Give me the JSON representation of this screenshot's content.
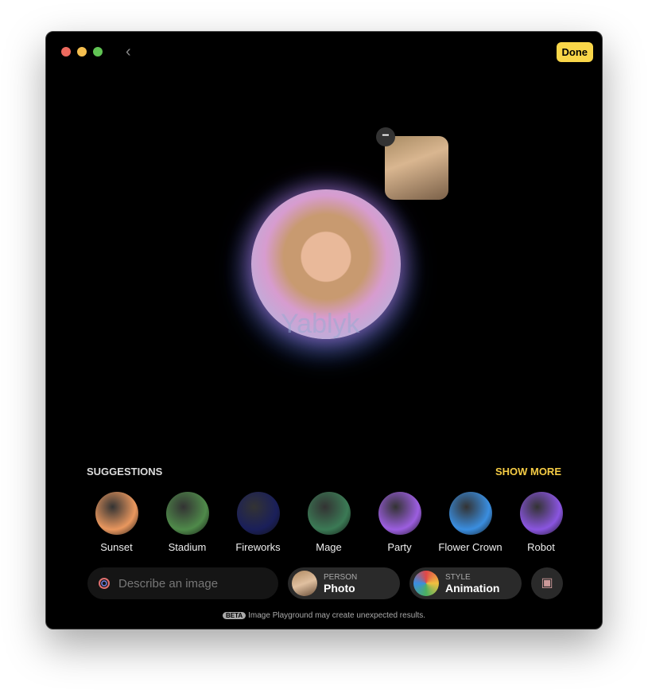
{
  "window": {
    "done_label": "Done",
    "back_icon": "chevron-left-icon",
    "controls": {
      "close": "#ed6a5e",
      "minimize": "#f5bf4f",
      "maximize": "#61c454"
    }
  },
  "canvas": {
    "watermark": "Yablyk",
    "remove_person_label": "−"
  },
  "suggestions": {
    "heading": "SUGGESTIONS",
    "show_more": "SHOW MORE",
    "items": [
      {
        "label": "Sunset",
        "color": "#e9975e"
      },
      {
        "label": "Stadium",
        "color": "#4f8a4a"
      },
      {
        "label": "Fireworks",
        "color": "#1a1f5a"
      },
      {
        "label": "Mage",
        "color": "#3b7a55"
      },
      {
        "label": "Party",
        "color": "#9c5ee0"
      },
      {
        "label": "Flower Crown",
        "color": "#3a8ee0"
      },
      {
        "label": "Robot",
        "color": "#8a55e0"
      }
    ]
  },
  "bottom": {
    "describe_placeholder": "Describe an image",
    "person": {
      "caption": "PERSON",
      "value": "Photo"
    },
    "style": {
      "caption": "STYLE",
      "value": "Animation"
    },
    "beta_badge": "BETA",
    "beta_text": "Image Playground may create unexpected results."
  }
}
